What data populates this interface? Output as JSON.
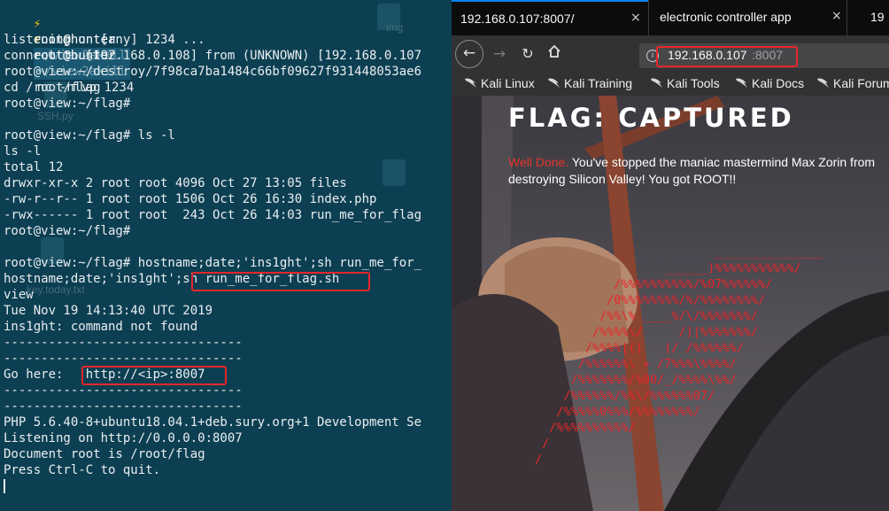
{
  "terminal": {
    "prompt_user": "root@hunter",
    "prompt_path": "~/view2akill",
    "command": "nc -nlvp 1234",
    "lines": [
      "listening on [any] 1234 ...",
      "connect to [192.168.0.108] from (UNKNOWN) [192.168.0.107",
      "root@view:~/destroy/7f98ca7ba1484c66bf09627f931448053ae6",
      "cd /root/flag",
      "root@view:~/flag#",
      "",
      "root@view:~/flag# ls -l",
      "ls -l",
      "total 12",
      "drwxr-xr-x 2 root root 4096 Oct 27 13:05 files",
      "-rw-r--r-- 1 root root 1506 Oct 26 16:30 index.php",
      "-rwx------ 1 root root  243 Oct 26 14:03 run_me_for_flag",
      "root@view:~/flag#",
      "",
      "root@view:~/flag# hostname;date;'ins1ght';sh run_me_for_",
      "hostname;date;'ins1ght';sh run_me_for_flag.sh",
      "view",
      "Tue Nov 19 14:13:40 UTC 2019",
      "ins1ght: command not found",
      "--------------------------------",
      "--------------------------------",
      "Go here:   http://<ip>:8007",
      "--------------------------------",
      "--------------------------------",
      "PHP 5.6.40-8+ubuntu18.04.1+deb.sury.org+1 Development Se",
      "Listening on http://0.0.0.0:8007",
      "Document root is /root/flag",
      "Press Ctrl-C to quit."
    ],
    "desktop_labels": [
      "img",
      "SSH.py",
      "key.today.txt"
    ]
  },
  "browser": {
    "tabs": [
      {
        "label": "192.168.0.107:8007/",
        "close": "×"
      },
      {
        "label": "electronic controller app",
        "close": "×"
      },
      {
        "label": "19"
      }
    ],
    "url_host": "192.168.0.107",
    "url_port": ":8007",
    "bookmarks": [
      "Kali Linux",
      "Kali Training",
      "Kali Tools",
      "Kali Docs",
      "Kali Forums"
    ],
    "page": {
      "title": "FLAG: CAPTURED",
      "well_done": "Well Done.",
      "message": " You've stopped the maniac mastermind Max Zorin from destroying Silicon Valley! You got ROOT!!",
      "ascii_art": [
        "                         _______________",
        "                  ______)%%%%%%%%%%%/",
        "           /%%%%%%%%%%/%07%%%%%%/",
        "          /0%%%%%%%%/%/%%%%%%%%/",
        "         /%%\\% ____%/\\/%%%%%%%/",
        "        /%%%%\\/     /)|%%%%%%%/",
        "       /%%%%|()   (/ /%%%%%%/",
        "      /%%%%%%\\ + /7%%%\\%%%%/",
        "     /%%%%%%%/%00/_/%%%%\\%%/",
        "    /%%%%%%/%%\\/%%%%%%07/",
        "   /%%%%%0%%%/%%%%%%%%/",
        "  /%%%%%%%%%%/",
        " /",
        "/"
      ]
    }
  },
  "colors": {
    "terminal_bg": "#0d3f52",
    "highlight_box": "#e8262a",
    "ascii_red": "#e8262a",
    "bolt_yellow": "#f4c20d"
  }
}
